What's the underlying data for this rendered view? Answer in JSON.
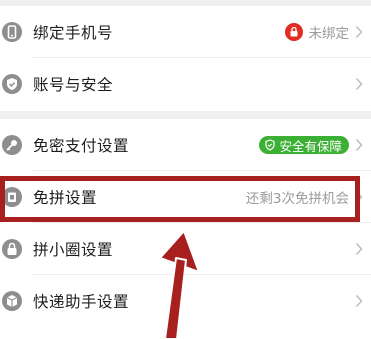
{
  "settings": {
    "group1": [
      {
        "label": "绑定手机号",
        "icon": "phone-icon",
        "status": "未绑定",
        "status_icon": "lock-icon"
      },
      {
        "label": "账号与安全",
        "icon": "shield-check-icon"
      }
    ],
    "group2": [
      {
        "label": "免密支付设置",
        "icon": "key-icon",
        "badge": "安全有保障",
        "badge_icon": "shield-icon",
        "badge_color": "#3cb034"
      },
      {
        "label": "免拼设置",
        "icon": "free-group-icon",
        "status": "还剩3次免拼机会"
      },
      {
        "label": "拼小圈设置",
        "icon": "padlock-icon"
      },
      {
        "label": "快递助手设置",
        "icon": "package-icon"
      }
    ]
  },
  "colors": {
    "accent_red": "#e02e24",
    "annotation_red": "#a71f1f",
    "badge_green": "#3cb034",
    "icon_gray": "#8e8e8e"
  }
}
